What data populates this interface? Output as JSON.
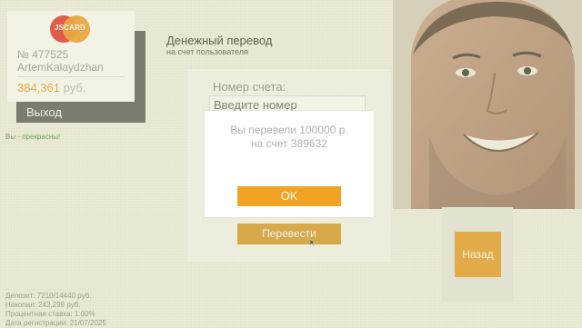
{
  "account": {
    "logo_text": "JSCARD",
    "number": "№ 477525",
    "name": "ArtemKalaydzhan",
    "balance": "384,361",
    "currency": "руб.",
    "logout_label": "Выход"
  },
  "greeting": {
    "prefix": "Вы - ",
    "highlight": "прекрасны!"
  },
  "page": {
    "title": "Денежный перевод",
    "subtitle": "на счет пользователя"
  },
  "form": {
    "account_label": "Номер счета:",
    "account_placeholder": "Введите номер",
    "submit_label": "Перевести"
  },
  "side": {
    "back_label": "Назад"
  },
  "info": {
    "deposit": "Депозит: 7210/14440 руб.",
    "savings": "Накопил: 242,299 руб.",
    "rate": "Процентная ставка: 1.00%",
    "registered": "Дата регистрации: 21/07/2025"
  },
  "modal": {
    "line1": "Вы перевели 100000 р.",
    "line2": "на счет 389632",
    "ok_label": "OK"
  },
  "colors": {
    "accent": "#f1a323",
    "brand_red": "#e8312a",
    "brand_orange": "#f39a1e",
    "greeting_green": "#3a9a3a"
  }
}
